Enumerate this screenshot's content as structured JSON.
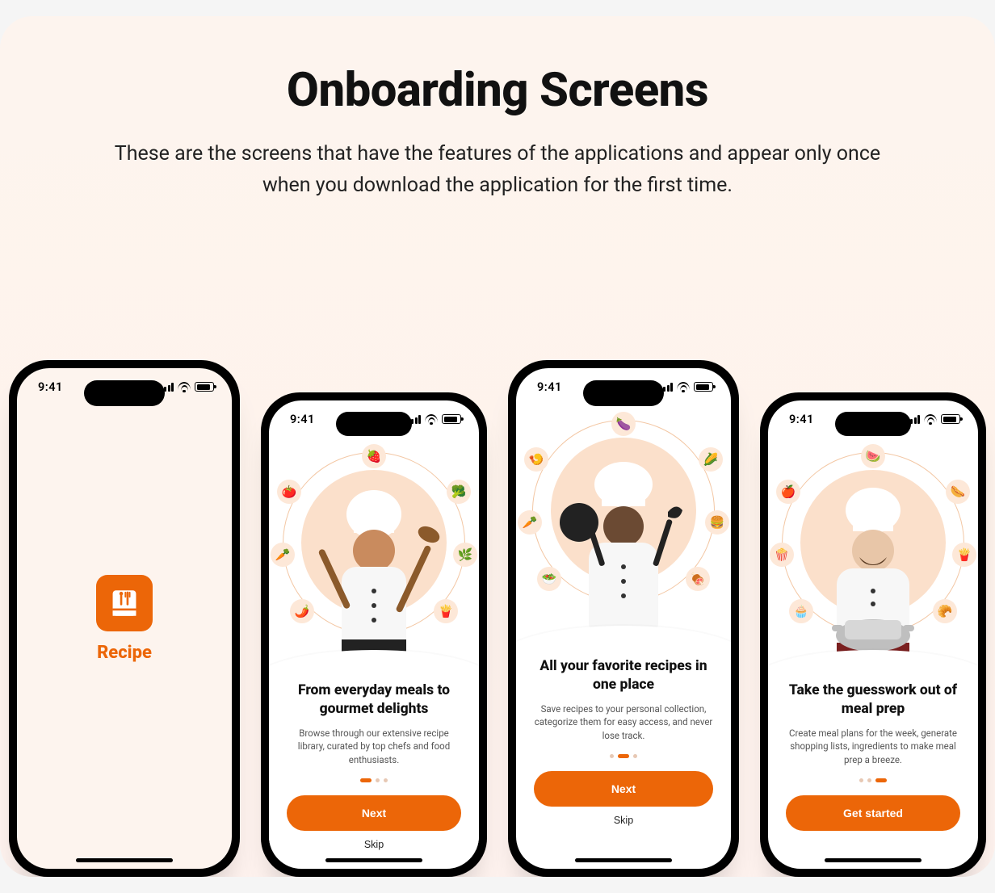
{
  "page": {
    "title": "Onboarding Screens",
    "subtitle": "These are the screens that have the features of the applications and appear only once when you download the application for the first time."
  },
  "status": {
    "time": "9:41"
  },
  "colors": {
    "accent": "#ec6608",
    "bubble": "#fde8d8",
    "circle": "#fbe0cb"
  },
  "splash": {
    "app_name": "Recipe"
  },
  "screens": [
    {
      "title": "From everyday meals to gourmet delights",
      "desc": "Browse through our extensive recipe library, curated by top chefs and food enthusiasts.",
      "primary": "Next",
      "secondary": "Skip",
      "active_dot": 0,
      "bubbles": [
        "🍓",
        "🥦",
        "🌿",
        "🍟",
        "🌶️",
        "🥕",
        "🍅"
      ]
    },
    {
      "title": "All your favorite recipes in one place",
      "desc": "Save recipes to your personal collection, categorize them for easy access, and never lose track.",
      "primary": "Next",
      "secondary": "Skip",
      "active_dot": 1,
      "bubbles": [
        "🍆",
        "🌽",
        "🍔",
        "🍖",
        "🥗",
        "🥕",
        "🍤"
      ]
    },
    {
      "title": "Take the guesswork out of meal prep",
      "desc": "Create meal plans for the week, generate shopping lists,  ingredients to make meal prep a breeze.",
      "primary": "Get started",
      "secondary": "",
      "active_dot": 2,
      "bubbles": [
        "🍉",
        "🌭",
        "🍟",
        "🥐",
        "🧁",
        "🍿",
        "🍎"
      ]
    }
  ]
}
